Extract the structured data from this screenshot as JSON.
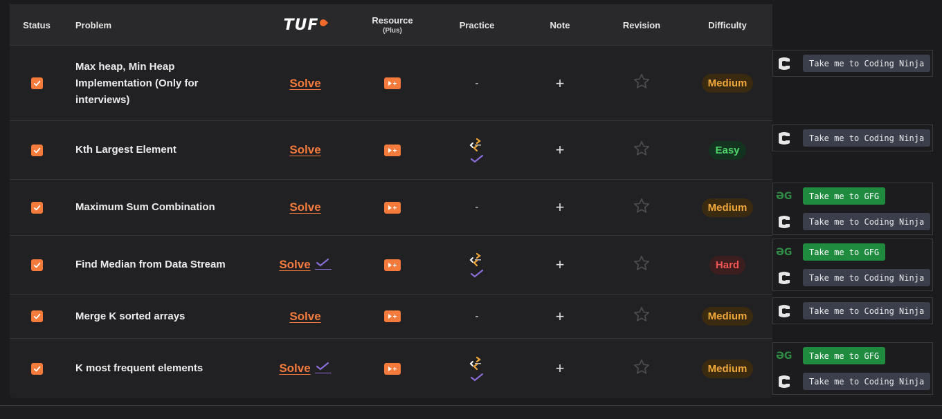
{
  "header": {
    "status": "Status",
    "problem": "Problem",
    "tuf_logo": "TUF",
    "resource": "Resource",
    "resource_sub": "(Plus)",
    "practice": "Practice",
    "note": "Note",
    "revision": "Revision",
    "difficulty": "Difficulty"
  },
  "rows": [
    {
      "problem": "Max heap, Min Heap Implementation (Only for interviews)",
      "solve": "Solve",
      "practice": "-",
      "difficulty": "Medium",
      "checked": true
    },
    {
      "problem": "Kth Largest Element",
      "solve": "Solve",
      "practice": "",
      "difficulty": "Easy",
      "checked": true
    },
    {
      "problem": "Maximum Sum Combination",
      "solve": "Solve",
      "practice": "-",
      "difficulty": "Medium",
      "checked": true
    },
    {
      "problem": "Find Median from Data Stream",
      "solve": "Solve",
      "practice": "",
      "difficulty": "Hard",
      "checked": true
    },
    {
      "problem": "Merge K sorted arrays",
      "solve": "Solve",
      "practice": "-",
      "difficulty": "Medium",
      "checked": true
    },
    {
      "problem": "K most frequent elements",
      "solve": "Solve",
      "practice": "",
      "difficulty": "Medium",
      "checked": true
    }
  ],
  "links": {
    "ninja_label": "Take me to Coding Ninja",
    "gfg_label": "Take me to GFG",
    "gfg_icon_text": "ƏG"
  },
  "colors": {
    "accent": "#f47b3b",
    "medium": "#f0a83a",
    "easy": "#4fd66b",
    "hard": "#ef5454",
    "gfg_green": "#1f8b3f",
    "purple_tick": "#8a6dd6"
  }
}
